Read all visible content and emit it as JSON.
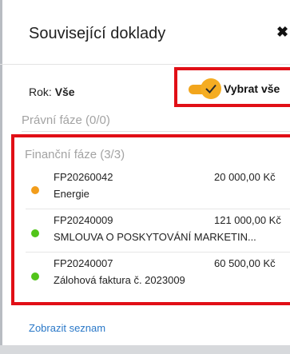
{
  "header": {
    "title": "Související doklady",
    "close_symbol": "✖"
  },
  "filter": {
    "year_label": "Rok:",
    "year_value": "Vše"
  },
  "toggle": {
    "label": "Vybrat vše",
    "checked": true,
    "color": "#f2a51c"
  },
  "phases": {
    "legal": {
      "label": "Právní fáze (0/0)"
    },
    "financial": {
      "label": "Finanční fáze (3/3)"
    }
  },
  "documents": [
    {
      "number": "FP20260042",
      "amount": "20 000,00 Kč",
      "description": "Energie",
      "status_color": "#f29d1b"
    },
    {
      "number": "FP20240009",
      "amount": "121 000,00 Kč",
      "description": "SMLOUVA O POSKYTOVÁNÍ MARKETIN...",
      "status_color": "#52c41a"
    },
    {
      "number": "FP20240007",
      "amount": "60 500,00 Kč",
      "description": "Zálohová faktura č. 2023009",
      "status_color": "#52c41a"
    }
  ],
  "footer": {
    "link_label": "Zobrazit seznam"
  },
  "highlight_color": "#e10f16"
}
